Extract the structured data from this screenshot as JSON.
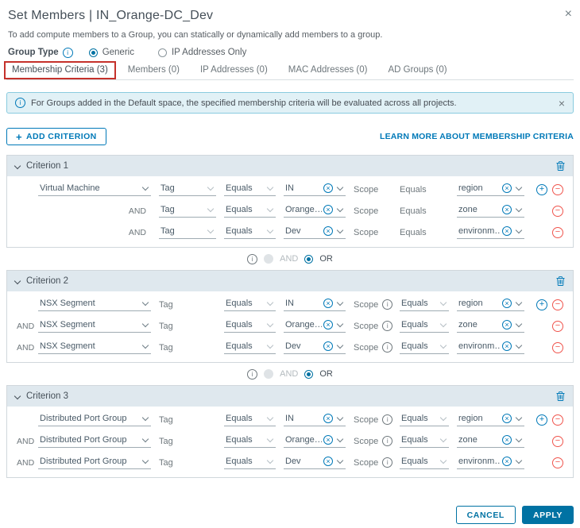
{
  "dialog": {
    "title": "Set Members | IN_Orange-DC_Dev",
    "description": "To add compute members to a Group, you can statically or dynamically add members to a group.",
    "group_type": {
      "label": "Group Type",
      "options": [
        {
          "label": "Generic",
          "selected": true
        },
        {
          "label": "IP Addresses Only",
          "selected": false
        }
      ]
    },
    "tabs": [
      {
        "label": "Membership Criteria (3)",
        "active": true,
        "highlighted": true
      },
      {
        "label": "Members (0)",
        "active": false
      },
      {
        "label": "IP Addresses (0)",
        "active": false
      },
      {
        "label": "MAC Addresses (0)",
        "active": false
      },
      {
        "label": "AD Groups (0)",
        "active": false
      }
    ],
    "banner": {
      "text": "For Groups added in the Default space, the specified membership criteria will be evaluated across all projects."
    },
    "toolbar": {
      "add_criterion_label": "ADD CRITERION",
      "learn_more_label": "LEARN MORE ABOUT MEMBERSHIP CRITERIA"
    },
    "joiner": {
      "and_label": "AND",
      "or_label": "OR"
    },
    "criteria": [
      {
        "title": "Criterion 1",
        "rows": [
          {
            "and": "",
            "entity": "Virtual Machine",
            "tag": "Tag",
            "operator": "Equals",
            "value": "IN",
            "scope_label": "Scope",
            "scope_operator": "Equals",
            "scope_value": "region"
          },
          {
            "and": "AND",
            "tag": "Tag",
            "operator": "Equals",
            "value": "Orange…",
            "scope_label": "Scope",
            "scope_operator": "Equals",
            "scope_value": "zone"
          },
          {
            "and": "AND",
            "tag": "Tag",
            "operator": "Equals",
            "value": "Dev",
            "scope_label": "Scope",
            "scope_operator": "Equals",
            "scope_value": "environm…"
          }
        ]
      },
      {
        "title": "Criterion 2",
        "rows": [
          {
            "and": "",
            "entity": "NSX Segment",
            "tag": "Tag",
            "operator": "Equals",
            "value": "IN",
            "scope_label": "Scope",
            "scope_operator": "Equals",
            "scope_value": "region"
          },
          {
            "and": "AND",
            "entity": "NSX Segment",
            "tag": "Tag",
            "operator": "Equals",
            "value": "Orange…",
            "scope_label": "Scope",
            "scope_operator": "Equals",
            "scope_value": "zone"
          },
          {
            "and": "AND",
            "entity": "NSX Segment",
            "tag": "Tag",
            "operator": "Equals",
            "value": "Dev",
            "scope_label": "Scope",
            "scope_operator": "Equals",
            "scope_value": "environm…"
          }
        ]
      },
      {
        "title": "Criterion 3",
        "rows": [
          {
            "and": "",
            "entity": "Distributed Port Group",
            "tag": "Tag",
            "operator": "Equals",
            "value": "IN",
            "scope_label": "Scope",
            "scope_operator": "Equals",
            "scope_value": "region"
          },
          {
            "and": "AND",
            "entity": "Distributed Port Group",
            "tag": "Tag",
            "operator": "Equals",
            "value": "Orange…",
            "scope_label": "Scope",
            "scope_operator": "Equals",
            "scope_value": "zone"
          },
          {
            "and": "AND",
            "entity": "Distributed Port Group",
            "tag": "Tag",
            "operator": "Equals",
            "value": "Dev",
            "scope_label": "Scope",
            "scope_operator": "Equals",
            "scope_value": "environm…"
          }
        ]
      }
    ],
    "footer": {
      "cancel_label": "CANCEL",
      "apply_label": "APPLY"
    }
  }
}
